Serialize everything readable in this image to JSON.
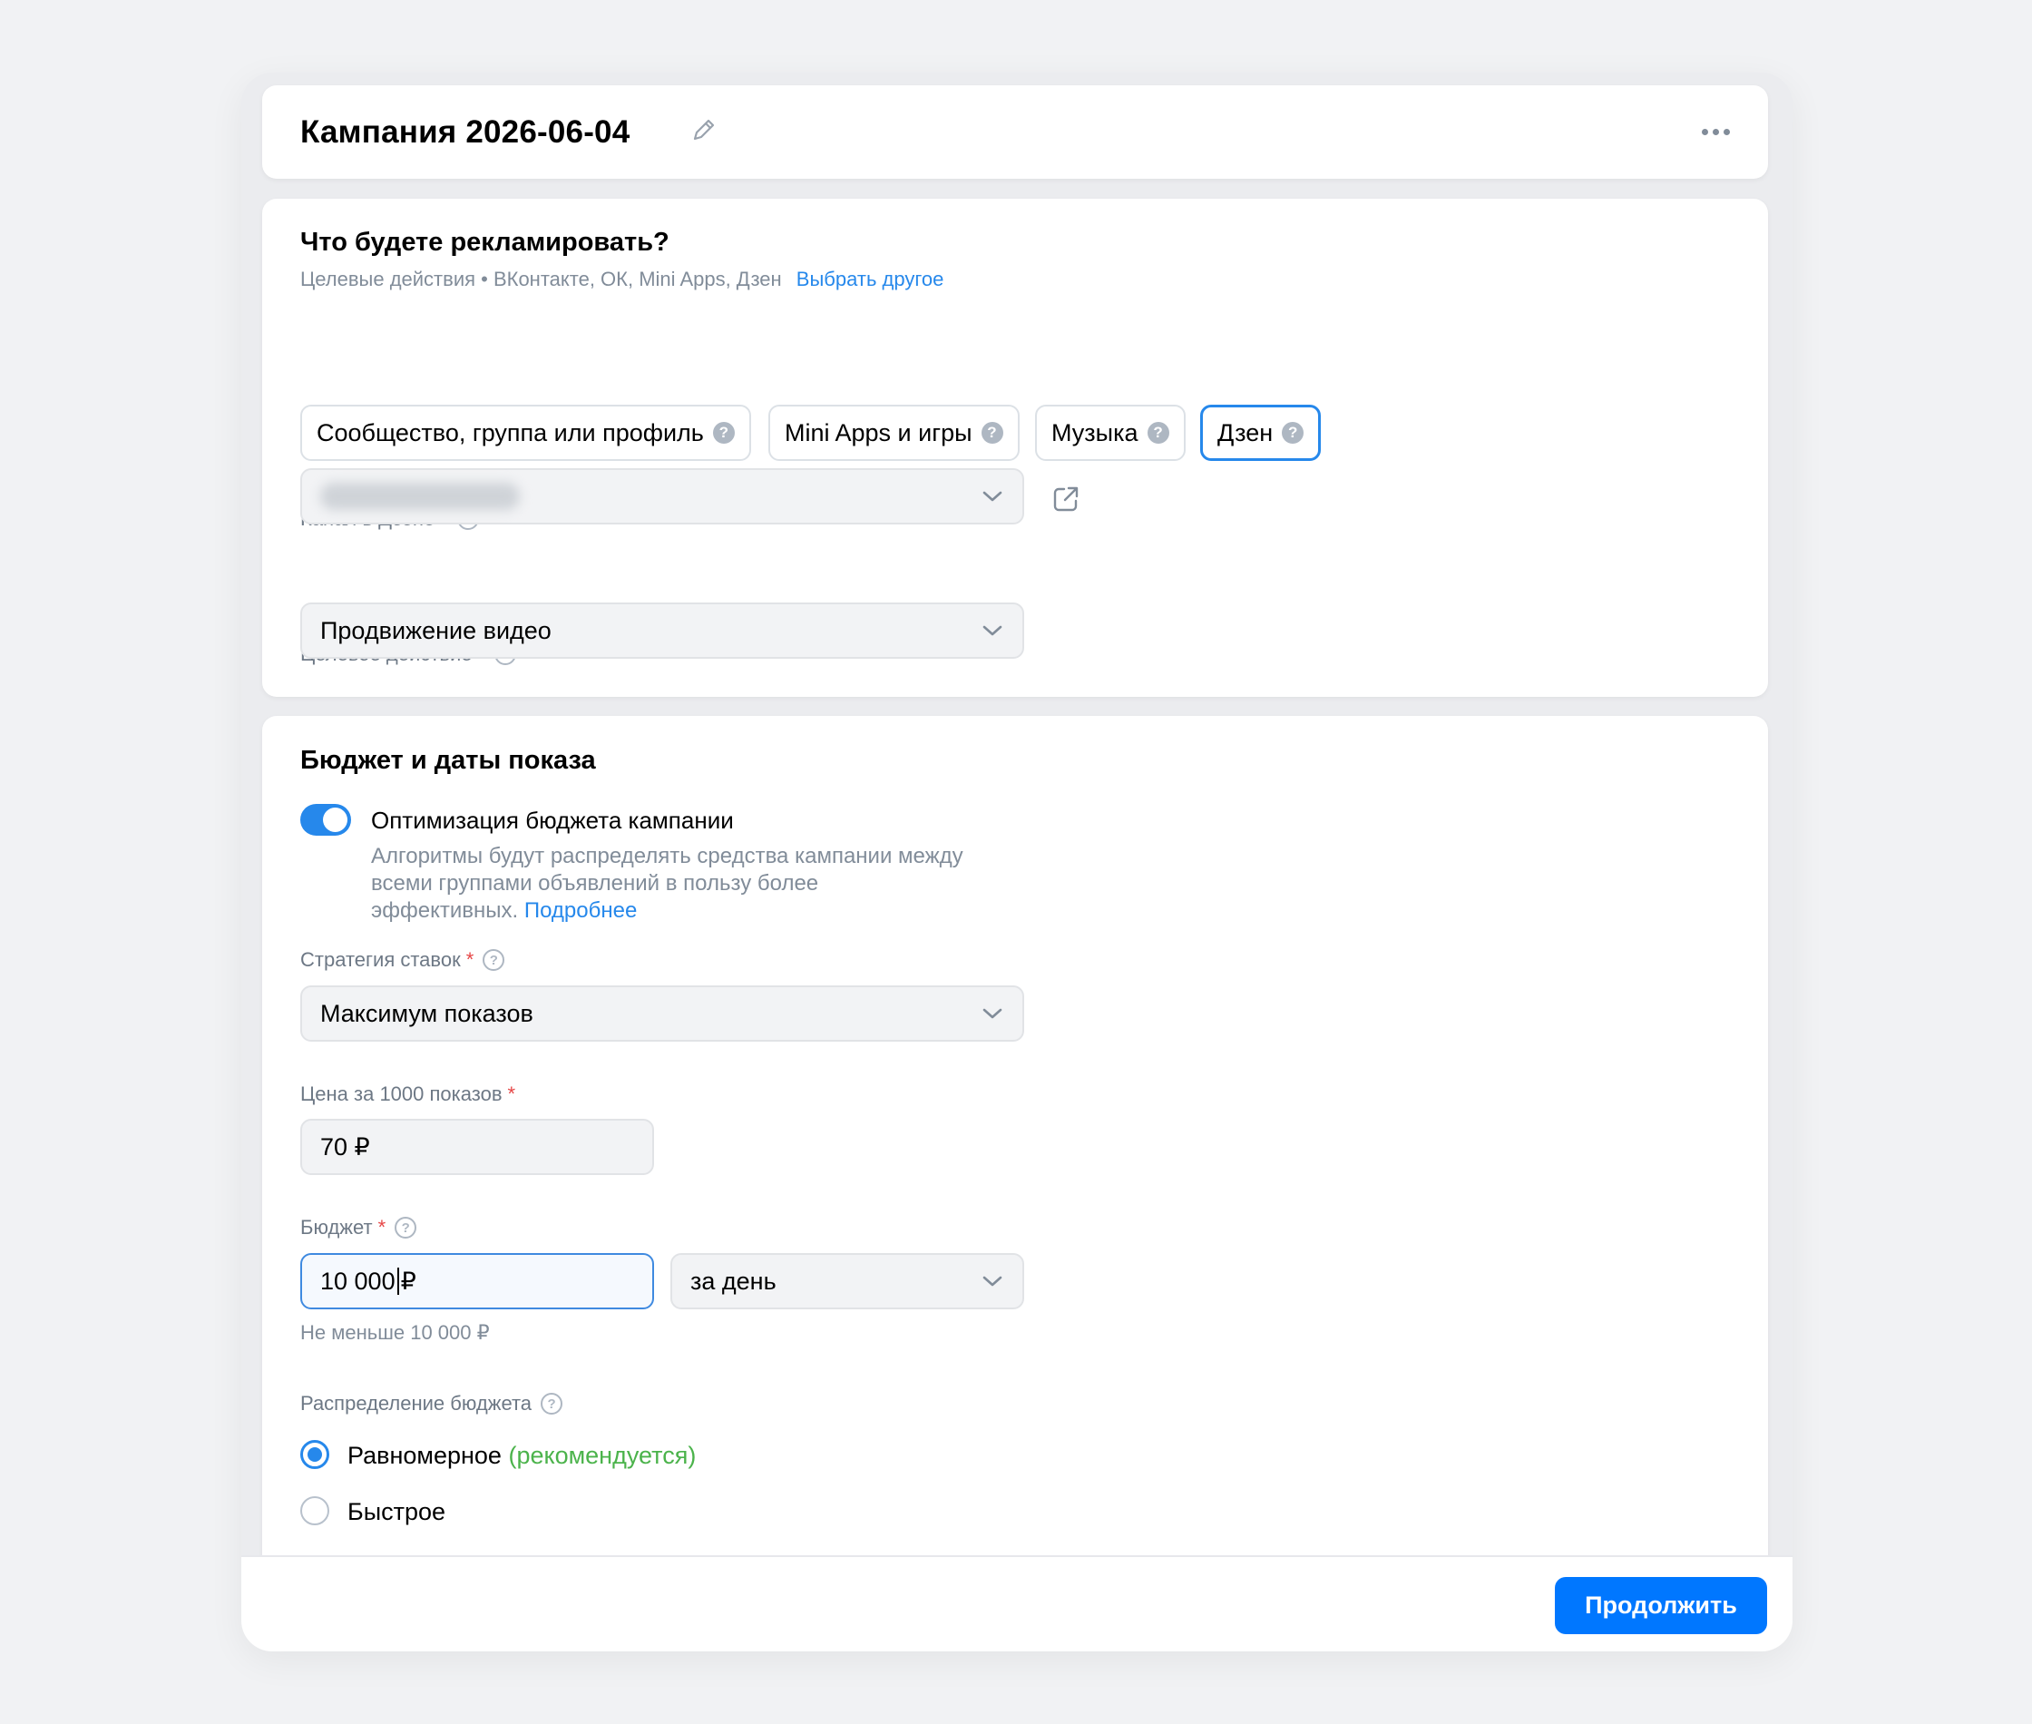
{
  "header": {
    "title": "Кампания 2026-06-04"
  },
  "promote": {
    "heading": "Что будете рекламировать?",
    "subtitle_prefix": "Целевые действия • ВКонтакте, ОК, Mini Apps, Дзен",
    "subtitle_link": "Выбрать другое",
    "chips": [
      {
        "label": "Сообщество, группа или профиль",
        "selected": false
      },
      {
        "label": "Mini Apps и игры",
        "selected": false
      },
      {
        "label": "Музыка",
        "selected": false
      },
      {
        "label": "Дзен",
        "selected": true
      }
    ],
    "channel_label": "Канал в Дзене",
    "target_label": "Целевое действие",
    "target_value": "Продвижение видео"
  },
  "budget": {
    "heading": "Бюджет и даты показа",
    "optimization": {
      "enabled": true,
      "title": "Оптимизация бюджета кампании",
      "desc_line1": "Алгоритмы будут распределять средства кампании между",
      "desc_line2": "всеми группами объявлений в пользу более",
      "desc_line3": "эффективных.",
      "desc_link": "Подробнее"
    },
    "strategy_label": "Стратегия ставок",
    "strategy_value": "Максимум показов",
    "price_label": "Цена за 1000 показов",
    "price_value": "70 ₽",
    "budget_label": "Бюджет",
    "budget_value": "10 000",
    "budget_currency": "₽",
    "period_value": "за день",
    "budget_hint": "Не меньше 10 000 ₽",
    "distribution_label": "Распределение бюджета",
    "distribution_options": [
      {
        "label": "Равномерное",
        "note": "(рекомендуется)",
        "selected": true
      },
      {
        "label": "Быстрое",
        "note": "",
        "selected": false
      }
    ]
  },
  "footer": {
    "continue_label": "Продолжить"
  },
  "colors": {
    "accent": "#2688eb",
    "primary_button": "#0077ff",
    "required": "#e64646",
    "recommended": "#4bb34b"
  }
}
